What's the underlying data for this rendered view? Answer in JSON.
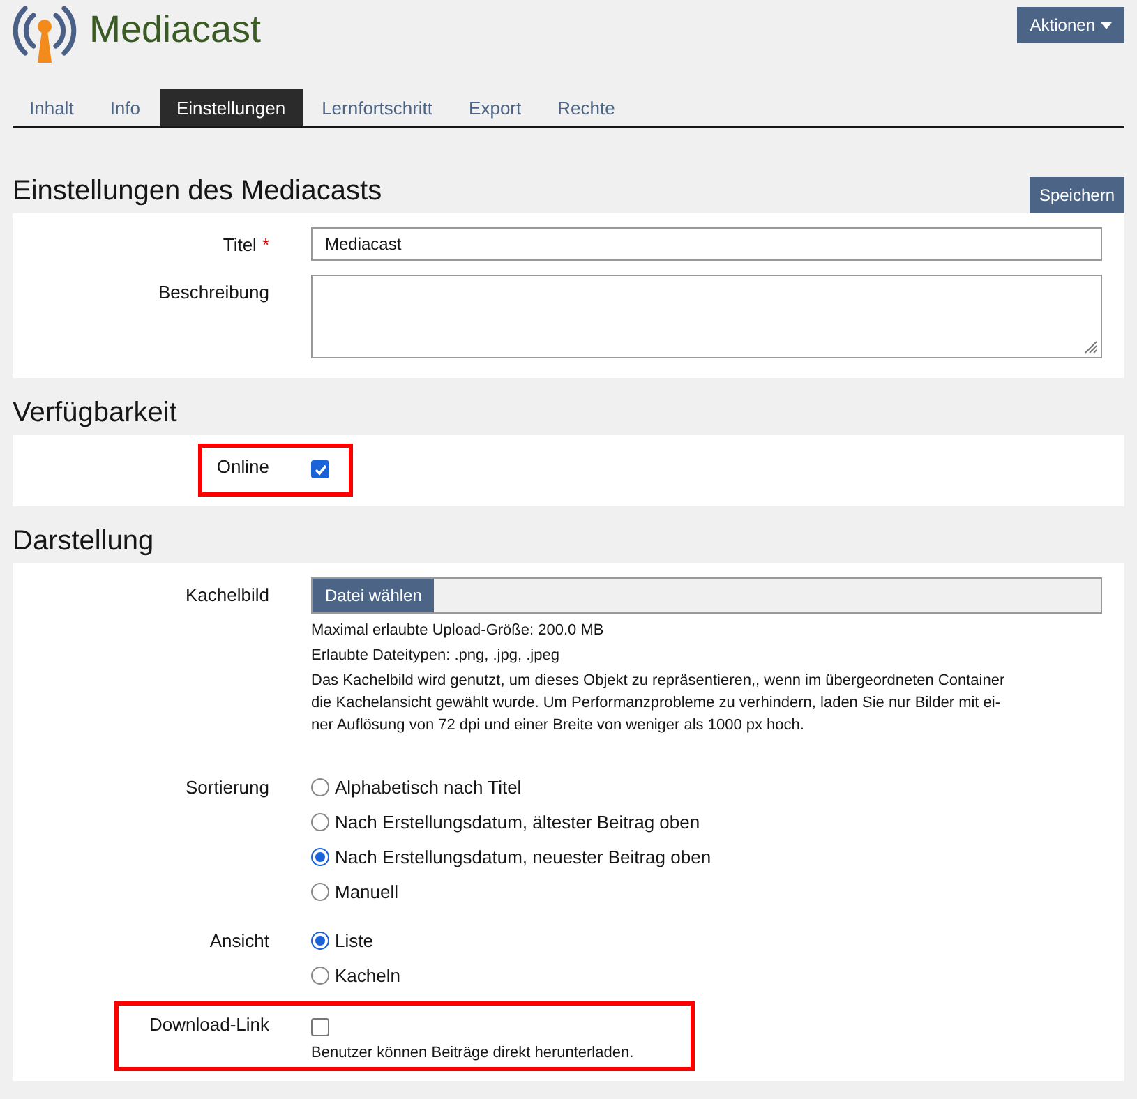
{
  "header": {
    "title": "Mediacast",
    "actions_button": "Aktionen"
  },
  "tabs": [
    {
      "label": "Inhalt",
      "selected": false
    },
    {
      "label": "Info",
      "selected": false
    },
    {
      "label": "Einstellungen",
      "selected": true
    },
    {
      "label": "Lernfortschritt",
      "selected": false
    },
    {
      "label": "Export",
      "selected": false
    },
    {
      "label": "Rechte",
      "selected": false
    }
  ],
  "save_button": "Speichern",
  "sections": [
    {
      "heading": "Einstellungen des Mediacasts",
      "fields": [
        {
          "kind": "text",
          "label": "Titel",
          "required_mark": "*",
          "value": "Mediacast"
        },
        {
          "kind": "textarea",
          "label": "Beschreibung"
        }
      ]
    },
    {
      "heading": "Verfügbarkeit",
      "fields": [
        {
          "kind": "checkbox",
          "label": "Online",
          "checked": true,
          "highlight": true
        }
      ]
    },
    {
      "heading": "Darstellung",
      "fields": [
        {
          "kind": "file",
          "label": "Kachelbild",
          "button": "Datei wählen",
          "notes": [
            "Maximal erlaubte Upload-Größe: 200.0 MB",
            "Erlaubte Dateitypen: .png, .jpg, .jpeg"
          ],
          "description_lines": [
            "Das Kachelbild wird genutzt, um dieses Objekt zu repräsentieren,, wenn im übergeordneten Container",
            "die Kachelansicht gewählt wurde. Um Performanzprobleme zu verhindern, laden Sie nur Bilder mit ei-",
            "ner Auflösung von 72 dpi und einer Breite von weniger als 1000 px hoch."
          ]
        },
        {
          "kind": "radio",
          "label": "Sortierung",
          "options": [
            {
              "label": "Alphabetisch nach Titel",
              "selected": false
            },
            {
              "label": "Nach Erstellungsdatum, ältester Beitrag oben",
              "selected": false
            },
            {
              "label": "Nach Erstellungsdatum, neuester Beitrag oben",
              "selected": true
            },
            {
              "label": "Manuell",
              "selected": false
            }
          ]
        },
        {
          "kind": "radio",
          "label": "Ansicht",
          "options": [
            {
              "label": "Liste",
              "selected": true
            },
            {
              "label": "Kacheln",
              "selected": false
            }
          ]
        },
        {
          "kind": "checkbox",
          "label": "Download-Link",
          "checked": false,
          "highlight": true,
          "help": "Benutzer können Beiträge direkt herunterladen."
        }
      ]
    }
  ]
}
